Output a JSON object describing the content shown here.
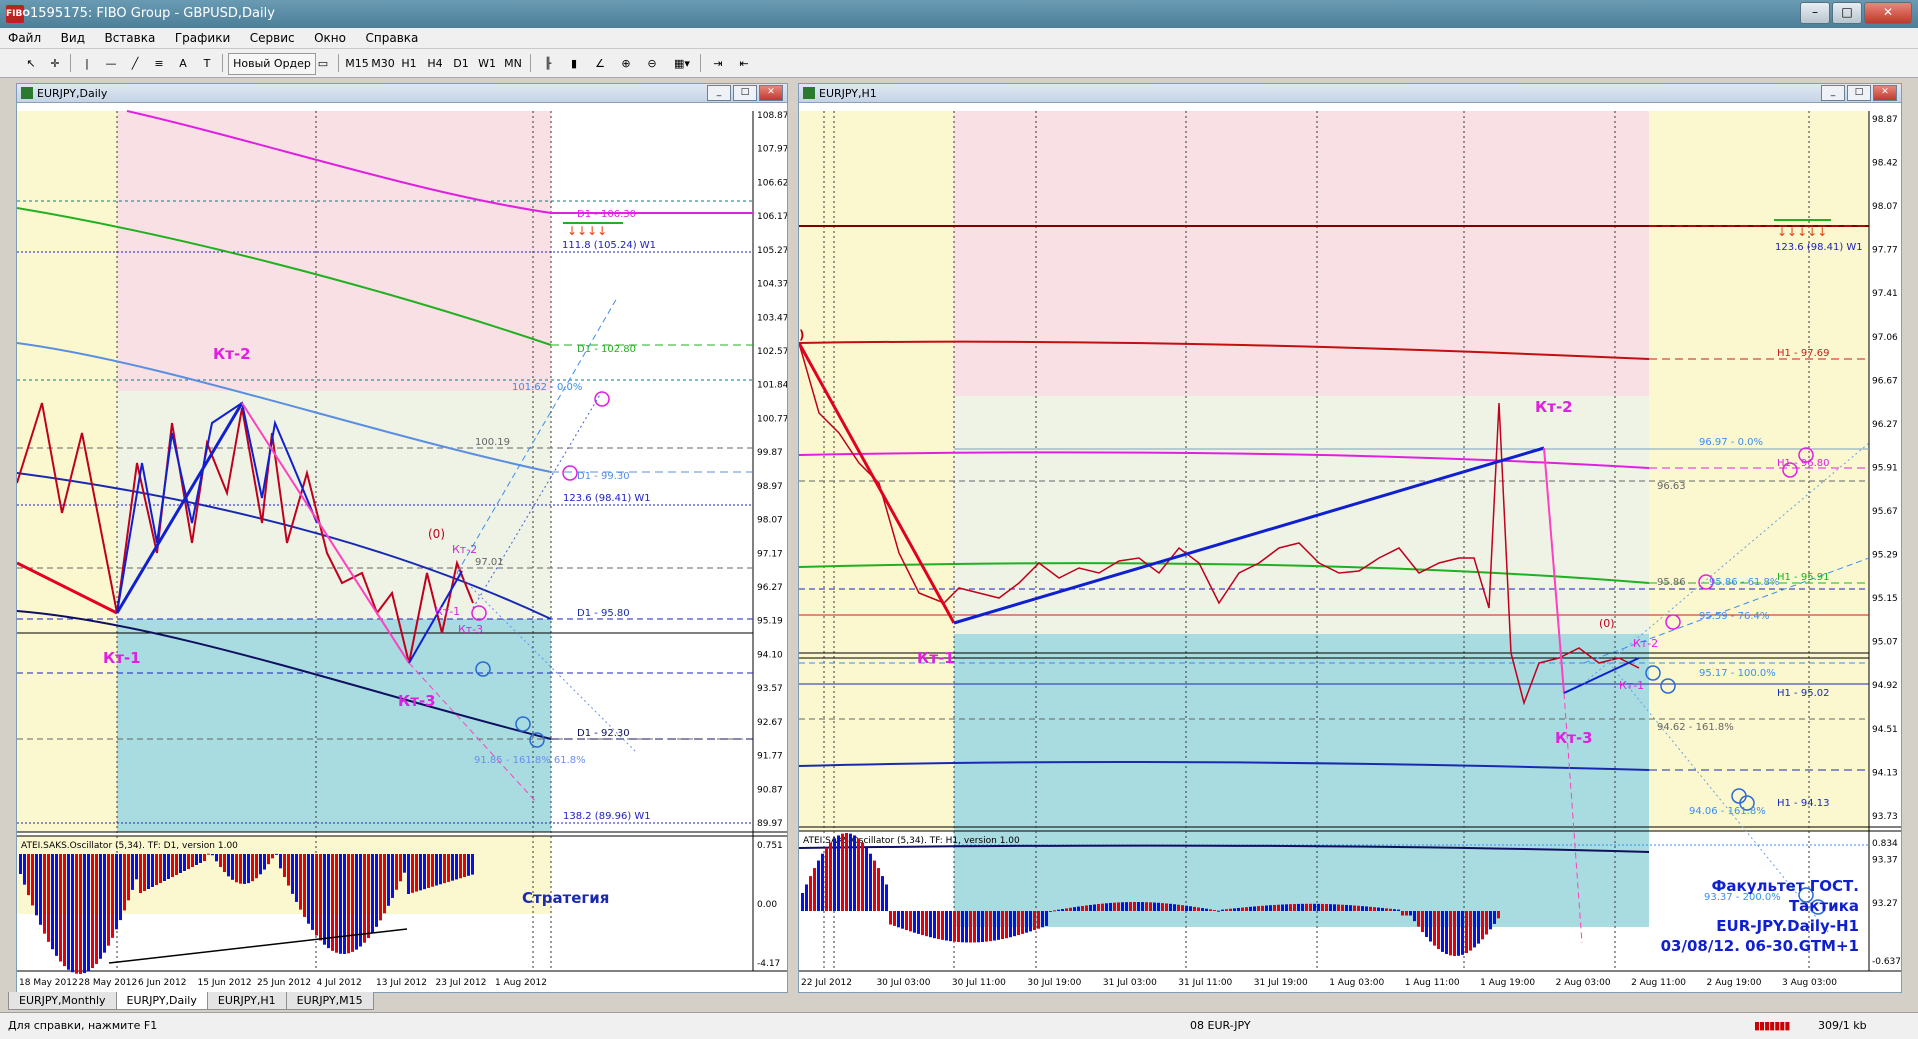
{
  "window": {
    "title": "1595175: FIBO Group - GBPUSD,Daily",
    "app_icon": "FIBO"
  },
  "menu": [
    "Файл",
    "Вид",
    "Вставка",
    "Графики",
    "Сервис",
    "Окно",
    "Справка"
  ],
  "toolbar": {
    "new_order": "Новый Ордер",
    "timeframes": [
      "M15",
      "M30",
      "H1",
      "H4",
      "D1",
      "W1",
      "MN"
    ]
  },
  "left_chart": {
    "title": "EURJPY,Daily",
    "oscillator_label": "ATEI.SAKS.Oscillator (5,34). TF: D1, version 1.00",
    "strategy_label": "Стратегия",
    "price_axis": [
      "108.87",
      "107.97",
      "106.62",
      "106.17",
      "105.27",
      "104.37",
      "103.47",
      "102.57",
      "101.84",
      "100.77",
      "99.87",
      "98.97",
      "98.07",
      "97.17",
      "96.27",
      "95.19",
      "94.10",
      "93.57",
      "92.67",
      "91.77",
      "90.87",
      "89.97"
    ],
    "osc_axis": [
      "0.751",
      "0.00",
      "-4.17"
    ],
    "time_axis": [
      "18 May 2012",
      "28 May 2012",
      "6 Jun 2012",
      "15 Jun 2012",
      "25 Jun 2012",
      "4 Jul 2012",
      "13 Jul 2012",
      "23 Jul 2012",
      "1 Aug 2012"
    ],
    "labels": {
      "kt1": "Кт-1",
      "kt2": "Кт-2",
      "kt3": "Кт-3",
      "kt1s": "Кт-1",
      "kt2s": "Кт-2",
      "kt3s": "Кт-3",
      "zero": "(0)"
    },
    "levels": {
      "d1_10630": "D1 - 106.30",
      "w1_11168": "111.8 (105.24) W1",
      "d1_10280": "D1 - 102.80",
      "fib_10162": "101.62 - 0.0%",
      "v10019": "100.19",
      "d1_9930": "D1 - 99.30",
      "w1_1236": "123.6 (98.41) W1",
      "v9701": "97.01",
      "d1_9580": "D1 - 95.80",
      "d1_9230": "D1 - 92.30",
      "fib_9185": "91.85 - 161.8% 61.8%",
      "w1_1382": "138.2 (89.96) W1"
    }
  },
  "right_chart": {
    "title": "EURJPY,H1",
    "oscillator_label": "ATEI.SAKS.Oscillator (5,34). TF: H1, version 1.00",
    "price_axis": [
      "98.87",
      "98.42",
      "98.07",
      "97.77",
      "97.41",
      "97.06",
      "96.67",
      "96.27",
      "95.91",
      "95.67",
      "95.29",
      "95.15",
      "95.07",
      "94.92",
      "94.51",
      "94.13",
      "93.73",
      "93.37",
      "93.27"
    ],
    "osc_axis": [
      "0.834",
      "-0.637"
    ],
    "time_axis": [
      "22 Jul 2012",
      "30 Jul 03:00",
      "30 Jul 11:00",
      "30 Jul 19:00",
      "31 Jul 03:00",
      "31 Jul 11:00",
      "31 Jul 19:00",
      "1 Aug 03:00",
      "1 Aug 11:00",
      "1 Aug 19:00",
      "2 Aug 03:00",
      "2 Aug 11:00",
      "2 Aug 19:00",
      "3 Aug 03:00"
    ],
    "labels": {
      "kt1": "Кт-1",
      "kt2": "Кт-2",
      "kt3": "Кт-3",
      "kt1s": "Кт-1",
      "kt2s": "Кт-2",
      "zero": "(0)"
    },
    "levels": {
      "w1_1236": "123.6 (98.41) W1",
      "h1_9769": "H1 - 97.69",
      "fib_9697": "96.97 - 0.0%",
      "h1_9680": "H1 - 96.80",
      "v9663": "96.63",
      "v9586": "95.86",
      "fib_9586": "95.86 - 61.8%",
      "h1_9591": "H1 - 95.91",
      "fib_9559": "95.59 - 76.4%",
      "fib_9517": "95.17 - 100.0%",
      "h1_9502": "H1 - 95.02",
      "fib_9462": "94.62 - 161.8%",
      "h1_9413": "H1 - 94.13",
      "fib_9406": "94.06 - 161.8%",
      "fib_9337": "93.37 - 200.0%",
      "price_9559": "95.59",
      "price_9515": "95.15",
      "price_9492": "94.92"
    },
    "caption": [
      "Факультет ГОСТ.",
      "Тактика",
      "EUR-JPY.Daily-H1",
      "03/08/12. 06-30.GTM+1"
    ]
  },
  "tabs": [
    "EURJPY,Monthly",
    "EURJPY,Daily",
    "EURJPY,H1",
    "EURJPY,M15"
  ],
  "status": {
    "help": "Для справки, нажмите F1",
    "profile": "08 EUR-JPY",
    "traffic": "309/1 kb"
  },
  "colors": {
    "pink_zone": "#f9e0e4",
    "yellow_zone": "#fbf8d0",
    "blue_zone": "#a8dce0",
    "green_zone": "#edf4e6",
    "red": "#e0001c",
    "blue": "#1020d0",
    "magenta": "#e020e0"
  }
}
